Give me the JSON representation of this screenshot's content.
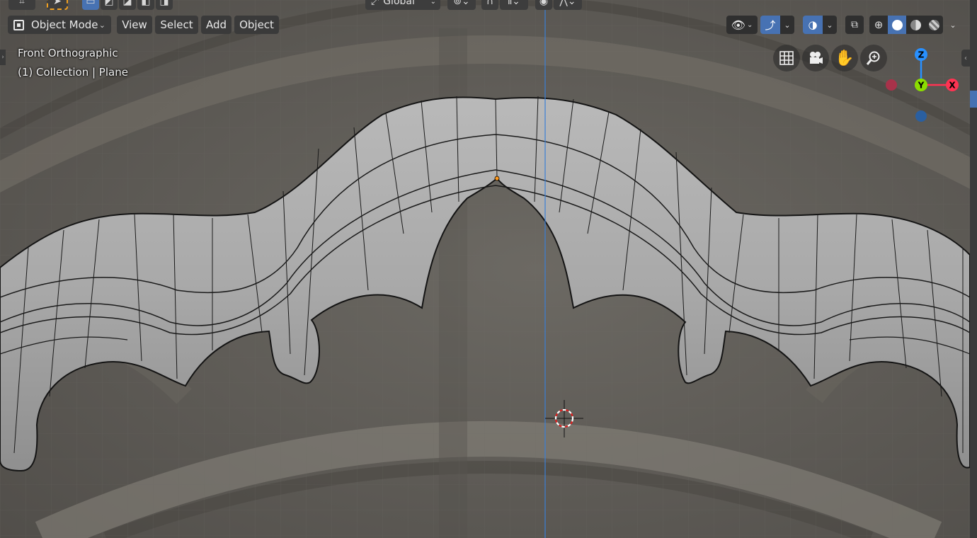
{
  "header": {
    "mode_label": "Object Mode",
    "menus": [
      "View",
      "Select",
      "Add",
      "Object"
    ],
    "transform_orientation": "Global"
  },
  "viewport": {
    "view_name": "Front Orthographic",
    "collection_info": "(1) Collection | Plane"
  },
  "gizmo": {
    "axis_z": "Z",
    "axis_y": "Y",
    "axis_x": "X",
    "colors": {
      "x": "#ff3352",
      "y": "#8bdc00",
      "z": "#2890ff"
    }
  },
  "icons": {
    "nav": [
      "grid-icon",
      "camera-icon",
      "hand-icon",
      "zoom-icon"
    ],
    "header_right": [
      "visibility-icon",
      "gizmo-icon",
      "overlay-icon",
      "xray-icon",
      "wireframe-shading-icon",
      "solid-shading-icon",
      "material-shading-icon",
      "rendered-shading-icon"
    ]
  },
  "accent_color": "#4772b3"
}
